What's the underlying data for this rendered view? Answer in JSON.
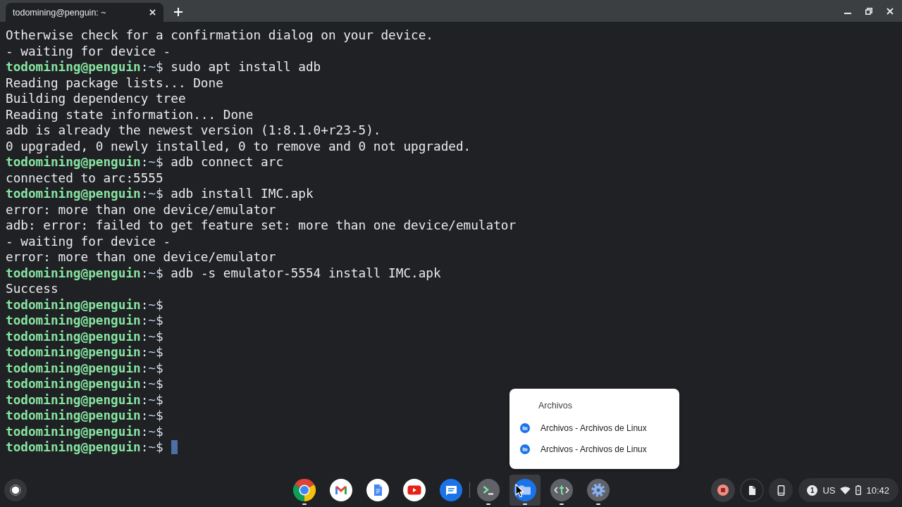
{
  "tabs": [
    {
      "title": "todomining@penguin: ~",
      "selected": true
    }
  ],
  "terminal": {
    "lines": [
      {
        "kind": "output",
        "text": "Otherwise check for a confirmation dialog on your device."
      },
      {
        "kind": "output",
        "text": "- waiting for device -"
      },
      {
        "kind": "prompt",
        "user": "todomining@penguin",
        "separator": ":",
        "path": "~",
        "symbol": "$",
        "command": "sudo apt install adb"
      },
      {
        "kind": "output",
        "text": "Reading package lists... Done"
      },
      {
        "kind": "output",
        "text": "Building dependency tree"
      },
      {
        "kind": "output",
        "text": "Reading state information... Done"
      },
      {
        "kind": "output",
        "text": "adb is already the newest version (1:8.1.0+r23-5)."
      },
      {
        "kind": "output",
        "text": "0 upgraded, 0 newly installed, 0 to remove and 0 not upgraded."
      },
      {
        "kind": "prompt",
        "user": "todomining@penguin",
        "separator": ":",
        "path": "~",
        "symbol": "$",
        "command": "adb connect arc"
      },
      {
        "kind": "output",
        "text": "connected to arc:5555"
      },
      {
        "kind": "prompt",
        "user": "todomining@penguin",
        "separator": ":",
        "path": "~",
        "symbol": "$",
        "command": "adb install IMC.apk"
      },
      {
        "kind": "output",
        "text": "error: more than one device/emulator"
      },
      {
        "kind": "output",
        "text": "adb: error: failed to get feature set: more than one device/emulator"
      },
      {
        "kind": "output",
        "text": "- waiting for device -"
      },
      {
        "kind": "output",
        "text": "error: more than one device/emulator"
      },
      {
        "kind": "prompt",
        "user": "todomining@penguin",
        "separator": ":",
        "path": "~",
        "symbol": "$",
        "command": "adb -s emulator-5554 install IMC.apk"
      },
      {
        "kind": "output",
        "text": "Success"
      },
      {
        "kind": "prompt",
        "user": "todomining@penguin",
        "separator": ":",
        "path": "~",
        "symbol": "$"
      },
      {
        "kind": "prompt",
        "user": "todomining@penguin",
        "separator": ":",
        "path": "~",
        "symbol": "$"
      },
      {
        "kind": "prompt",
        "user": "todomining@penguin",
        "separator": ":",
        "path": "~",
        "symbol": "$"
      },
      {
        "kind": "prompt",
        "user": "todomining@penguin",
        "separator": ":",
        "path": "~",
        "symbol": "$"
      },
      {
        "kind": "prompt",
        "user": "todomining@penguin",
        "separator": ":",
        "path": "~",
        "symbol": "$"
      },
      {
        "kind": "prompt",
        "user": "todomining@penguin",
        "separator": ":",
        "path": "~",
        "symbol": "$"
      },
      {
        "kind": "prompt",
        "user": "todomining@penguin",
        "separator": ":",
        "path": "~",
        "symbol": "$"
      },
      {
        "kind": "prompt",
        "user": "todomining@penguin",
        "separator": ":",
        "path": "~",
        "symbol": "$"
      },
      {
        "kind": "prompt",
        "user": "todomining@penguin",
        "separator": ":",
        "path": "~",
        "symbol": "$"
      },
      {
        "kind": "prompt",
        "user": "todomining@penguin",
        "separator": ":",
        "path": "~",
        "symbol": "$"
      }
    ],
    "cursor_visible": true
  },
  "context_menu": {
    "title": "Archivos",
    "items": [
      {
        "label": "Archivos - Archivos de Linux"
      },
      {
        "label": "Archivos - Archivos de Linux"
      }
    ]
  },
  "shelf": {
    "groups": [
      {
        "apps": [
          {
            "kind": "browser",
            "running": true,
            "selected": false
          },
          {
            "kind": "mail",
            "running": false,
            "selected": false
          },
          {
            "kind": "docs",
            "running": false,
            "selected": false
          },
          {
            "kind": "video",
            "running": false,
            "selected": false
          },
          {
            "kind": "messages",
            "running": false,
            "selected": false
          }
        ]
      },
      {
        "apps": [
          {
            "kind": "terminal",
            "running": true,
            "selected": false
          },
          {
            "kind": "files",
            "running": true,
            "selected": true
          },
          {
            "kind": "text",
            "running": true,
            "selected": false
          },
          {
            "kind": "settings",
            "running": true,
            "selected": false
          }
        ]
      }
    ]
  },
  "tray": {
    "notification_count": "1",
    "keyboard_layout": "US",
    "time": "10:42"
  }
}
